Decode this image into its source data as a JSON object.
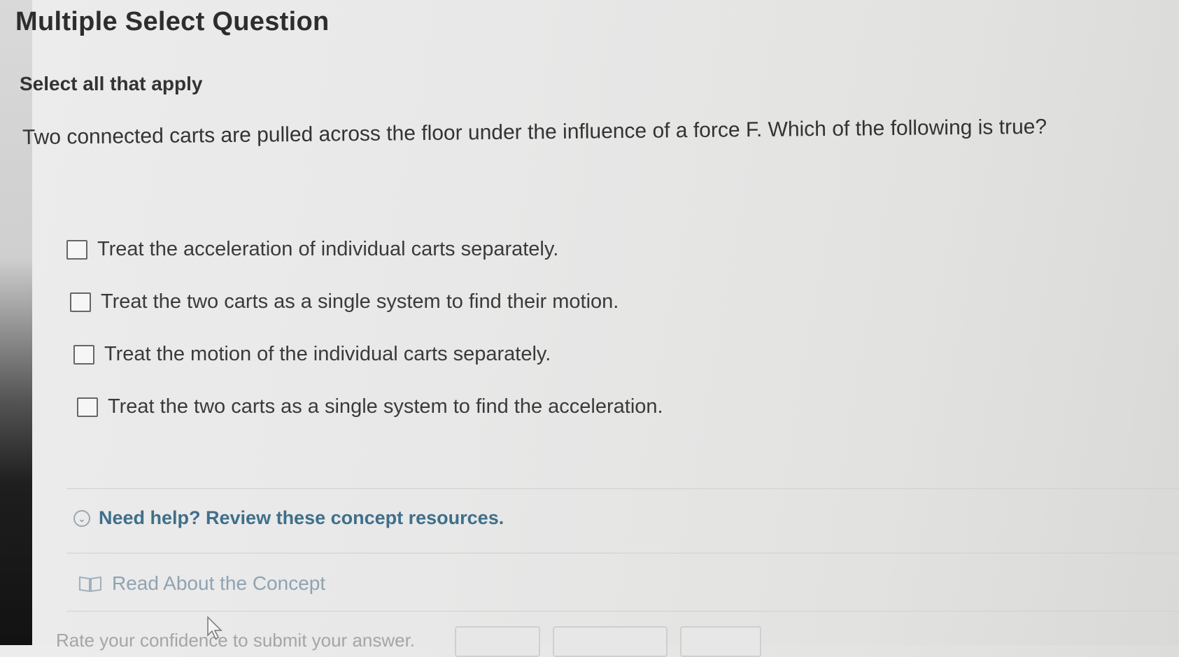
{
  "header": {
    "title": "Multiple Select Question"
  },
  "instruction": "Select all that apply",
  "question": "Two connected carts are pulled across the floor under the influence of a force F. Which of the following is true?",
  "options": [
    {
      "label": "Treat the acceleration of individual carts separately.",
      "checked": false
    },
    {
      "label": "Treat the two carts as a single system to find their motion.",
      "checked": false
    },
    {
      "label": "Treat the motion of the individual carts separately.",
      "checked": false
    },
    {
      "label": "Treat the two carts as a single system to find the acceleration.",
      "checked": false
    }
  ],
  "help": {
    "label": "Need help? Review these concept resources.",
    "icon": "chevron-down-circle-icon"
  },
  "resources": {
    "read_label": "Read About the Concept",
    "icon": "book-icon"
  },
  "confidence": {
    "prompt": "Rate your confidence to submit your answer."
  },
  "colors": {
    "help_link": "#3f6f8a",
    "resource_link": "#8fa3b2",
    "text": "#3a3a3a"
  }
}
